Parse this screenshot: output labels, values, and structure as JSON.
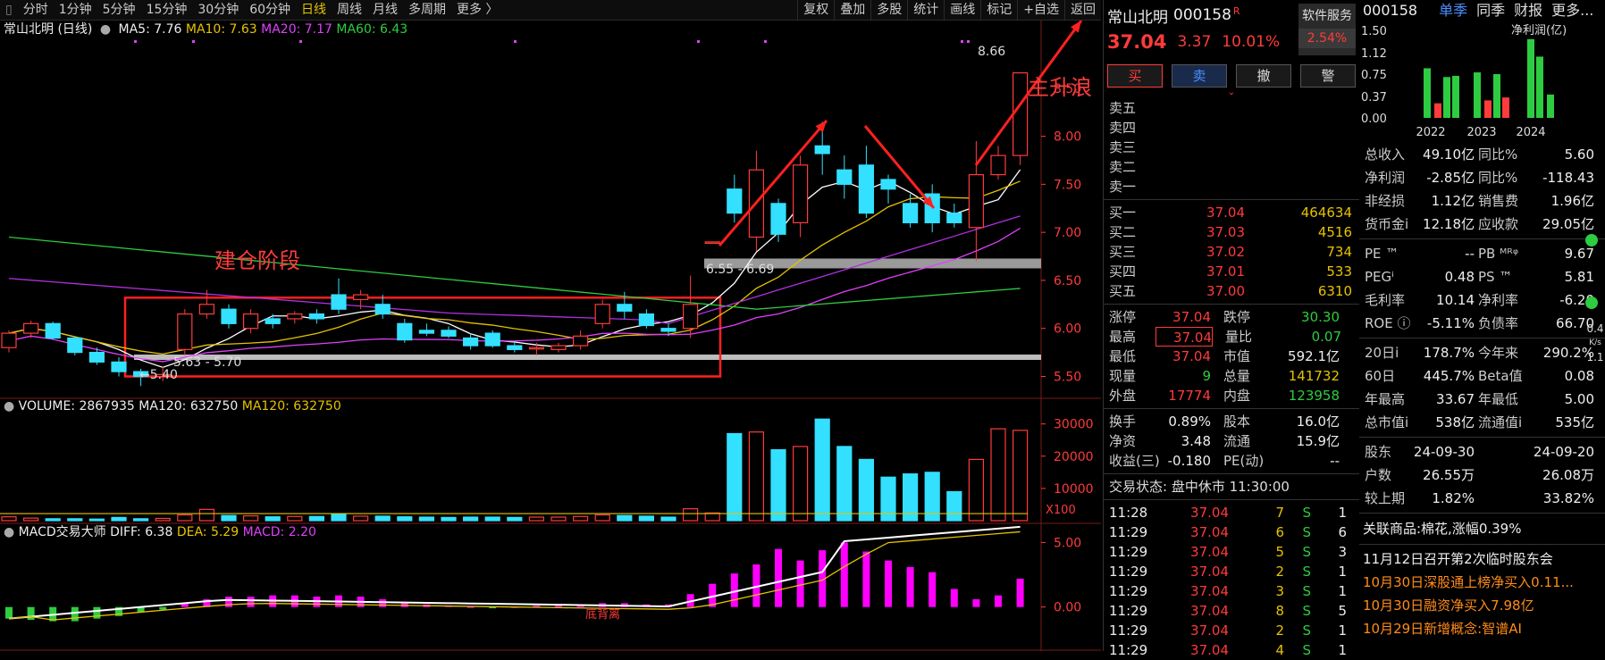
{
  "toolbar": {
    "periods": [
      "分时",
      "1分钟",
      "5分钟",
      "15分钟",
      "30分钟",
      "60分钟",
      "日线",
      "周线",
      "月线",
      "多周期",
      "更多 〉"
    ],
    "active": "日线",
    "tools": [
      "复权",
      "叠加",
      "多股",
      "统计",
      "画线",
      "标记",
      "+自选",
      "返回"
    ]
  },
  "legend": {
    "title": "常山北明 (日线)",
    "ma5": "MA5: 7.76",
    "ma10": "MA10: 7.63",
    "ma20": "MA20: 7.17",
    "ma60": "MA60: 6.43",
    "volume": "VOLUME: 2867935",
    "vma1": "MA120: 632750",
    "vma2": "MA120: 632750",
    "macd_title": "MACD交易大师",
    "diff": "DIFF: 6.38",
    "dea": "DEA: 5.29",
    "macd": "MACD: 2.20"
  },
  "annotations": {
    "build": "建仓阶段",
    "main": "主升浪",
    "range1": "6.55 - 6.69",
    "range2": "5.63 - 5.70",
    "low": "←5.40",
    "high": "8.66",
    "macd_note": "底背离",
    "x100": "X100"
  },
  "chart_data": {
    "type": "candlestick",
    "ylim": [
      5.3,
      9.0
    ],
    "price_ticks": [
      "8.50",
      "8.00",
      "7.50",
      "7.00",
      "6.50",
      "6.00",
      "5.50"
    ],
    "volume_ticks": [
      "30000",
      "20000",
      "10000"
    ],
    "macd_ticks": [
      "5.00",
      "0.00"
    ],
    "candles": [
      [
        5.8,
        5.95,
        5.75,
        5.98
      ],
      [
        5.95,
        6.05,
        5.9,
        6.08
      ],
      [
        6.05,
        5.9,
        5.88,
        6.07
      ],
      [
        5.9,
        5.75,
        5.72,
        5.92
      ],
      [
        5.75,
        5.65,
        5.62,
        5.8
      ],
      [
        5.65,
        5.55,
        5.5,
        5.7
      ],
      [
        5.55,
        5.5,
        5.4,
        5.58
      ],
      [
        5.5,
        5.52,
        5.45,
        5.6
      ],
      [
        5.78,
        6.15,
        5.72,
        6.2
      ],
      [
        6.15,
        6.25,
        6.1,
        6.4
      ],
      [
        6.2,
        6.05,
        6.0,
        6.25
      ],
      [
        6.0,
        6.15,
        5.95,
        6.2
      ],
      [
        6.1,
        6.05,
        6.0,
        6.15
      ],
      [
        6.1,
        6.15,
        6.05,
        6.18
      ],
      [
        6.15,
        6.1,
        6.05,
        6.2
      ],
      [
        6.35,
        6.2,
        6.15,
        6.52
      ],
      [
        6.3,
        6.35,
        6.2,
        6.4
      ],
      [
        6.25,
        6.15,
        6.1,
        6.35
      ],
      [
        6.05,
        5.88,
        5.85,
        6.1
      ],
      [
        5.98,
        5.95,
        5.92,
        6.05
      ],
      [
        5.98,
        5.92,
        5.9,
        6.02
      ],
      [
        5.9,
        5.82,
        5.78,
        5.95
      ],
      [
        5.95,
        5.82,
        5.8,
        5.98
      ],
      [
        5.82,
        5.78,
        5.75,
        5.85
      ],
      [
        5.8,
        5.8,
        5.72,
        5.85
      ],
      [
        5.78,
        5.82,
        5.75,
        5.85
      ],
      [
        5.82,
        5.92,
        5.78,
        5.98
      ],
      [
        6.05,
        6.25,
        6.0,
        6.3
      ],
      [
        6.25,
        6.18,
        6.1,
        6.38
      ],
      [
        6.15,
        6.03,
        6.0,
        6.2
      ],
      [
        6.0,
        5.97,
        5.92,
        6.05
      ],
      [
        6.0,
        6.25,
        5.9,
        6.55
      ],
      [
        6.9,
        6.9,
        6.9,
        6.9
      ],
      [
        7.45,
        7.2,
        7.1,
        7.6
      ],
      [
        6.95,
        7.65,
        6.8,
        7.85
      ],
      [
        7.3,
        6.98,
        6.9,
        7.35
      ],
      [
        7.1,
        7.7,
        6.95,
        7.8
      ],
      [
        7.9,
        7.82,
        7.6,
        8.15
      ],
      [
        7.65,
        7.5,
        7.35,
        7.8
      ],
      [
        7.7,
        7.2,
        7.15,
        7.9
      ],
      [
        7.55,
        7.45,
        7.3,
        7.6
      ],
      [
        7.3,
        7.1,
        7.05,
        7.4
      ],
      [
        7.4,
        7.1,
        7.0,
        7.5
      ],
      [
        7.2,
        7.1,
        7.05,
        7.3
      ],
      [
        7.05,
        7.6,
        6.7,
        7.95
      ],
      [
        7.6,
        7.8,
        7.55,
        7.9
      ],
      [
        7.8,
        8.66,
        7.7,
        8.66
      ]
    ],
    "volume": [
      1200,
      800,
      600,
      600,
      500,
      1000,
      600,
      700,
      1800,
      3500,
      1600,
      1500,
      1200,
      1300,
      1300,
      2100,
      1400,
      1400,
      1200,
      1100,
      1000,
      1100,
      1100,
      1000,
      1100,
      1100,
      1300,
      1800,
      1600,
      1400,
      1100,
      3700,
      2400,
      27000,
      27500,
      22000,
      23000,
      31500,
      23000,
      19000,
      13500,
      14500,
      15000,
      9000,
      19000,
      28500,
      28000
    ],
    "macd": [
      -0.9,
      -1.0,
      -1.1,
      -1.1,
      -0.9,
      -0.7,
      -0.4,
      -0.2,
      0.3,
      0.6,
      0.8,
      0.8,
      0.9,
      0.9,
      0.8,
      0.9,
      0.8,
      0.6,
      0.4,
      0.2,
      0.1,
      0.0,
      -0.1,
      0.0,
      0.1,
      0.1,
      0.1,
      0.3,
      0.3,
      0.2,
      0.2,
      1.0,
      1.8,
      2.6,
      3.3,
      4.5,
      3.6,
      4.4,
      5.0,
      4.3,
      3.6,
      3.1,
      2.7,
      1.4,
      0.6,
      0.9,
      2.2
    ]
  },
  "quote": {
    "name": "常山北明",
    "code": "000158",
    "r": "R",
    "service": "软件服务",
    "service_pct": "2.54%",
    "price": "37.04",
    "change": "3.37",
    "pct": "10.01%",
    "buttons": [
      "买",
      "卖",
      "撤",
      "警"
    ],
    "sells": [
      "卖五",
      "卖四",
      "卖三",
      "卖二",
      "卖一"
    ],
    "buys": [
      {
        "l": "买一",
        "p": "37.04",
        "v": "464634"
      },
      {
        "l": "买二",
        "p": "37.03",
        "v": "4516"
      },
      {
        "l": "买三",
        "p": "37.02",
        "v": "734"
      },
      {
        "l": "买四",
        "p": "37.01",
        "v": "533"
      },
      {
        "l": "买五",
        "p": "37.00",
        "v": "6310"
      }
    ],
    "stats": [
      {
        "a": "涨停",
        "b": "37.04",
        "c": "跌停",
        "d": "30.30"
      },
      {
        "a": "最高",
        "b": "37.04",
        "c": "量比",
        "d": "0.07"
      },
      {
        "a": "最低",
        "b": "37.04",
        "c": "市值",
        "d": "592.1亿"
      },
      {
        "a": "现量",
        "b": "9",
        "c": "总量",
        "d": "141732"
      },
      {
        "a": "外盘",
        "b": "17774",
        "c": "内盘",
        "d": "123958"
      }
    ],
    "stats2": [
      {
        "a": "换手",
        "b": "0.89%",
        "c": "股本",
        "d": "16.0亿"
      },
      {
        "a": "净资",
        "b": "3.48",
        "c": "流通",
        "d": "15.9亿"
      },
      {
        "a": "收益(三)",
        "b": "-0.180",
        "c": "PE(动)",
        "d": "--"
      }
    ],
    "status": "交易状态: 盘中休市 11:30:00",
    "ticks": [
      {
        "t": "11:28",
        "p": "37.04",
        "v": "7",
        "s": "S",
        "n": "1"
      },
      {
        "t": "11:29",
        "p": "37.04",
        "v": "6",
        "s": "S",
        "n": "6"
      },
      {
        "t": "11:29",
        "p": "37.04",
        "v": "5",
        "s": "S",
        "n": "3"
      },
      {
        "t": "11:29",
        "p": "37.04",
        "v": "2",
        "s": "S",
        "n": "1"
      },
      {
        "t": "11:29",
        "p": "37.04",
        "v": "3",
        "s": "S",
        "n": "1"
      },
      {
        "t": "11:29",
        "p": "37.04",
        "v": "8",
        "s": "S",
        "n": "5"
      },
      {
        "t": "11:29",
        "p": "37.04",
        "v": "2",
        "s": "S",
        "n": "1"
      },
      {
        "t": "11:29",
        "p": "37.04",
        "v": "4",
        "s": "S",
        "n": "1"
      }
    ]
  },
  "fund": {
    "code": "000158",
    "tabs": [
      "单季",
      "同季",
      "财报",
      "更多..."
    ],
    "chart_title": "净利润(亿)",
    "yticks": [
      "1.50",
      "1.12",
      "0.75",
      "0.37",
      "0.00"
    ],
    "years": [
      "2022",
      "2023",
      "2024"
    ],
    "bars": [
      {
        "v": 0.85,
        "c": "#2ecc40"
      },
      {
        "v": 0.25,
        "c": "#ff3b3b"
      },
      {
        "v": 0.7,
        "c": "#2ecc40"
      },
      {
        "v": 0.72,
        "c": "#2ecc40"
      },
      {
        "v": 0.78,
        "c": "#2ecc40"
      },
      {
        "v": 0.3,
        "c": "#ff3b3b"
      },
      {
        "v": 0.75,
        "c": "#2ecc40"
      },
      {
        "v": 0.35,
        "c": "#ff3b3b"
      },
      {
        "v": 1.35,
        "c": "#2ecc40"
      },
      {
        "v": 1.05,
        "c": "#2ecc40"
      },
      {
        "v": 0.4,
        "c": "#2ecc40"
      }
    ],
    "rows1": [
      {
        "a": "总收入",
        "b": "49.10亿",
        "c": "同比%",
        "d": "5.60"
      },
      {
        "a": "净利润",
        "b": "-2.85亿",
        "c": "同比%",
        "d": "-118.43"
      },
      {
        "a": "非经损",
        "b": "1.12亿",
        "c": "销售费",
        "d": "1.96亿"
      },
      {
        "a": "货币金i",
        "b": "12.18亿",
        "c": "应收款",
        "d": "29.05亿"
      }
    ],
    "rows2": [
      {
        "a": "PE ™",
        "b": "--",
        "c": "PB ᴹᴿᵠ",
        "d": "9.67"
      },
      {
        "a": "PEGⁱ",
        "b": "0.48",
        "c": "PS ™",
        "d": "5.81"
      },
      {
        "a": "毛利率",
        "b": "10.14",
        "c": "净利率",
        "d": "-6.20"
      },
      {
        "a": "ROE ⓘ",
        "b": "-5.11%",
        "c": "负债率",
        "d": "66.70"
      }
    ],
    "rows3": [
      {
        "a": "20日i",
        "b": "178.7%",
        "c": "今年来",
        "d": "290.2%"
      },
      {
        "a": "60日",
        "b": "445.7%",
        "c": "Beta值",
        "d": "0.08"
      },
      {
        "a": "年最高",
        "b": "33.67",
        "c": "年最低",
        "d": "5.00"
      },
      {
        "a": "总市值i",
        "b": "538亿",
        "c": "流通值i",
        "d": "535亿"
      }
    ],
    "rows4": [
      {
        "a": "股东",
        "b": "24-09-30",
        "c": "",
        "d": "24-09-20"
      },
      {
        "a": "户数",
        "b": "26.55万",
        "c": "",
        "d": "26.08万"
      },
      {
        "a": "较上期",
        "b": "1.82%",
        "c": "",
        "d": "33.82%"
      }
    ],
    "related": "关联商品:棉花,涨幅0.39%",
    "news": [
      "11月12日召开第2次临时股东会",
      "10月30日深股通上榜净买入0.11...",
      "10月30日融资净买入7.98亿",
      "10月29日新增概念:智谱AI"
    ],
    "side_text": [
      "0.4",
      "K/s",
      "1.1"
    ]
  }
}
